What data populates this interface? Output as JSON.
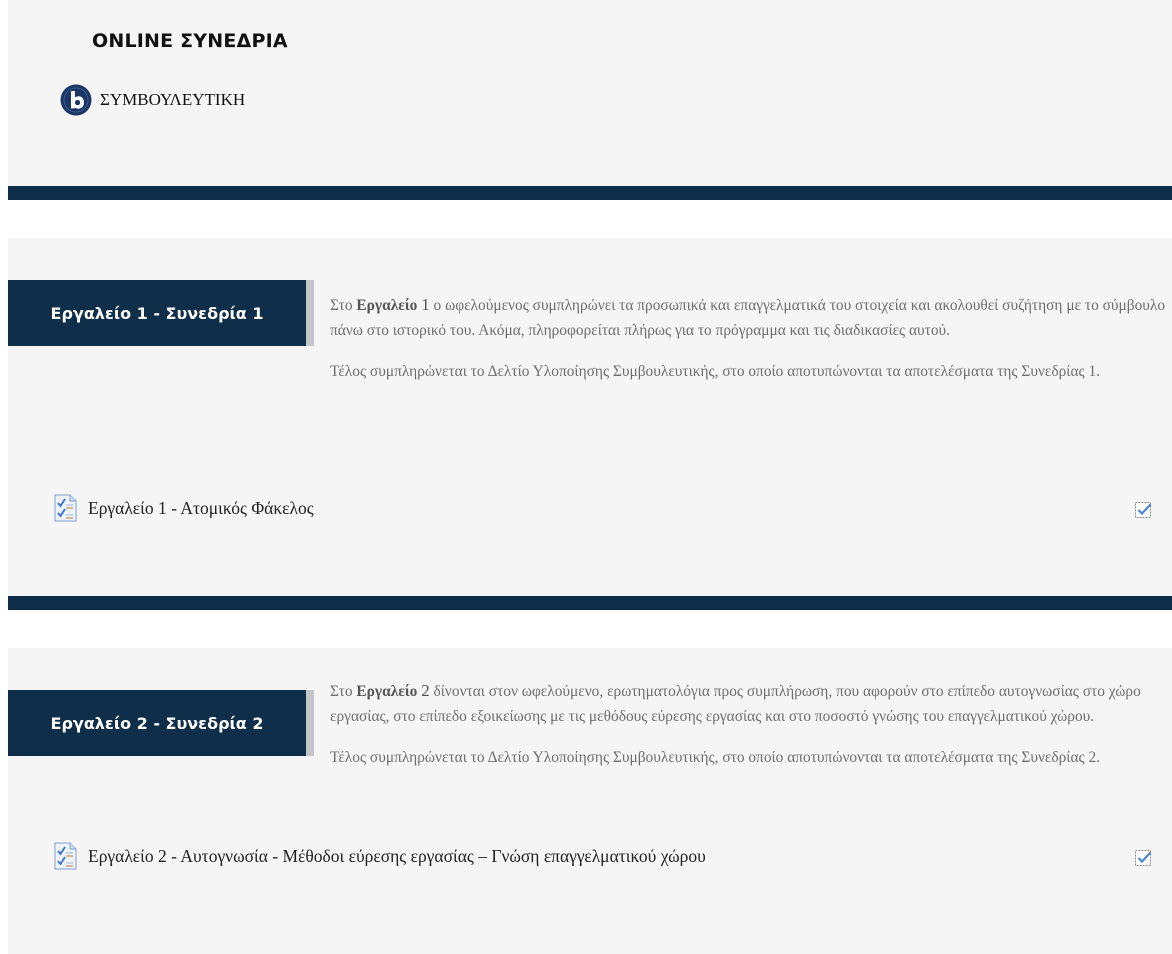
{
  "online_section": {
    "title": "ONLINE ΣΥΝΕΔΡΙΑ",
    "bbb_label": "ΣΥΜΒΟΥΛΕΥΤΙΚΗ",
    "bbb_icon": "bigbluebutton-icon"
  },
  "tools": [
    {
      "banner": "Εργαλείο 1 - Συνεδρία 1",
      "para1_prefix": "Στο ",
      "para1_bold": "Εργαλείο",
      "para1_num": "1",
      "para1_rest": " ο ωφελούμενος συμπληρώνει τα προσωπικά και επαγγελματικά του στοιχεία και ακολουθεί συζήτηση με το σύμβουλο πάνω στο ιστορικό του. Ακόμα, πληροφορείται πλήρως για το πρόγραμμα και τις διαδικασίες αυτού.",
      "para2": "Τέλος συμπληρώνεται το Δελτίο Υλοποίησης Συμβουλευτικής, στο οποίο αποτυπώνονται τα αποτελέσματα της  Συνεδρίας 1.",
      "activity": "Εργαλείο 1 - Ατομικός Φάκελος",
      "activity_icon": "quiz-icon",
      "completion_icon": "checkbox-checked-icon"
    },
    {
      "banner": "Εργαλείο 2 - Συνεδρία 2",
      "para1_prefix": "Στο ",
      "para1_bold": "Εργαλείο",
      "para1_num": "2",
      "para1_rest": " δίνονται στον ωφελούμενο, ερωτηματολόγια προς συμπλήρωση, που αφορούν στο επίπεδο αυτογνωσίας στο χώρο εργασίας, στο επίπεδο εξοικείωσης με  τις μεθόδους εύρεσης εργασίας και στο ποσοστό γνώσης του επαγγελματικού χώρου.",
      "para2": "Τέλος συμπληρώνεται το Δελτίο Υλοποίησης Συμβουλευτικής, στο οποίο αποτυπώνονται τα αποτελέσματα της  Συνεδρίας 2.",
      "activity": "Εργαλείο 2 - Αυτογνωσία - Μέθοδοι εύρεσης εργασίας – Γνώση επαγγελματικού χώρου",
      "activity_icon": "quiz-icon",
      "completion_icon": "checkbox-checked-icon"
    }
  ],
  "colors": {
    "navy": "#0f2e4a",
    "section_bg": "#f5f5f5",
    "banner_edge": "#c3c5c8",
    "desc_text": "#6e6e6e",
    "bbb_blue": "#1b3564"
  }
}
